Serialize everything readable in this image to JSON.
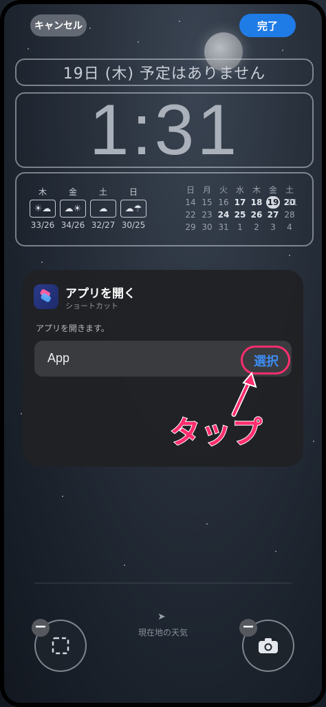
{
  "header": {
    "cancel_label": "キャンセル",
    "done_label": "完了"
  },
  "lockscreen": {
    "date_line": "19日 (木)  予定はありません",
    "time": "1:31"
  },
  "weather_widget": {
    "days": [
      {
        "day": "木",
        "icon": "sun-cloud-icon",
        "temp": "33/26"
      },
      {
        "day": "金",
        "icon": "cloud-sun-icon",
        "temp": "34/26"
      },
      {
        "day": "土",
        "icon": "cloud-icon",
        "temp": "32/27"
      },
      {
        "day": "日",
        "icon": "cloud-rain-icon",
        "temp": "30/25"
      }
    ]
  },
  "calendar_widget": {
    "weekdays": [
      "日",
      "月",
      "火",
      "水",
      "木",
      "金",
      "土"
    ],
    "rows": [
      [
        "14",
        "15",
        "16",
        "17",
        "18",
        "19",
        "20",
        "21"
      ],
      [
        "22",
        "23",
        "24",
        "25",
        "26",
        "27",
        "28"
      ],
      [
        "29",
        "30",
        "31",
        "1",
        "2",
        "3",
        "4"
      ]
    ],
    "today": "19"
  },
  "action_card": {
    "title": "アプリを開く",
    "subtitle": "ショートカット",
    "description": "アプリを開きます。",
    "param_label": "App",
    "select_label": "選択"
  },
  "annotation": {
    "text": "タップ",
    "color": "#ff2d6e"
  },
  "bottom_bar": {
    "location_weather": "現在地の天気"
  },
  "colors": {
    "accent_blue": "#1f7be6",
    "select_blue": "#3d8bf0",
    "highlight_pink": "#ff2d6e"
  }
}
